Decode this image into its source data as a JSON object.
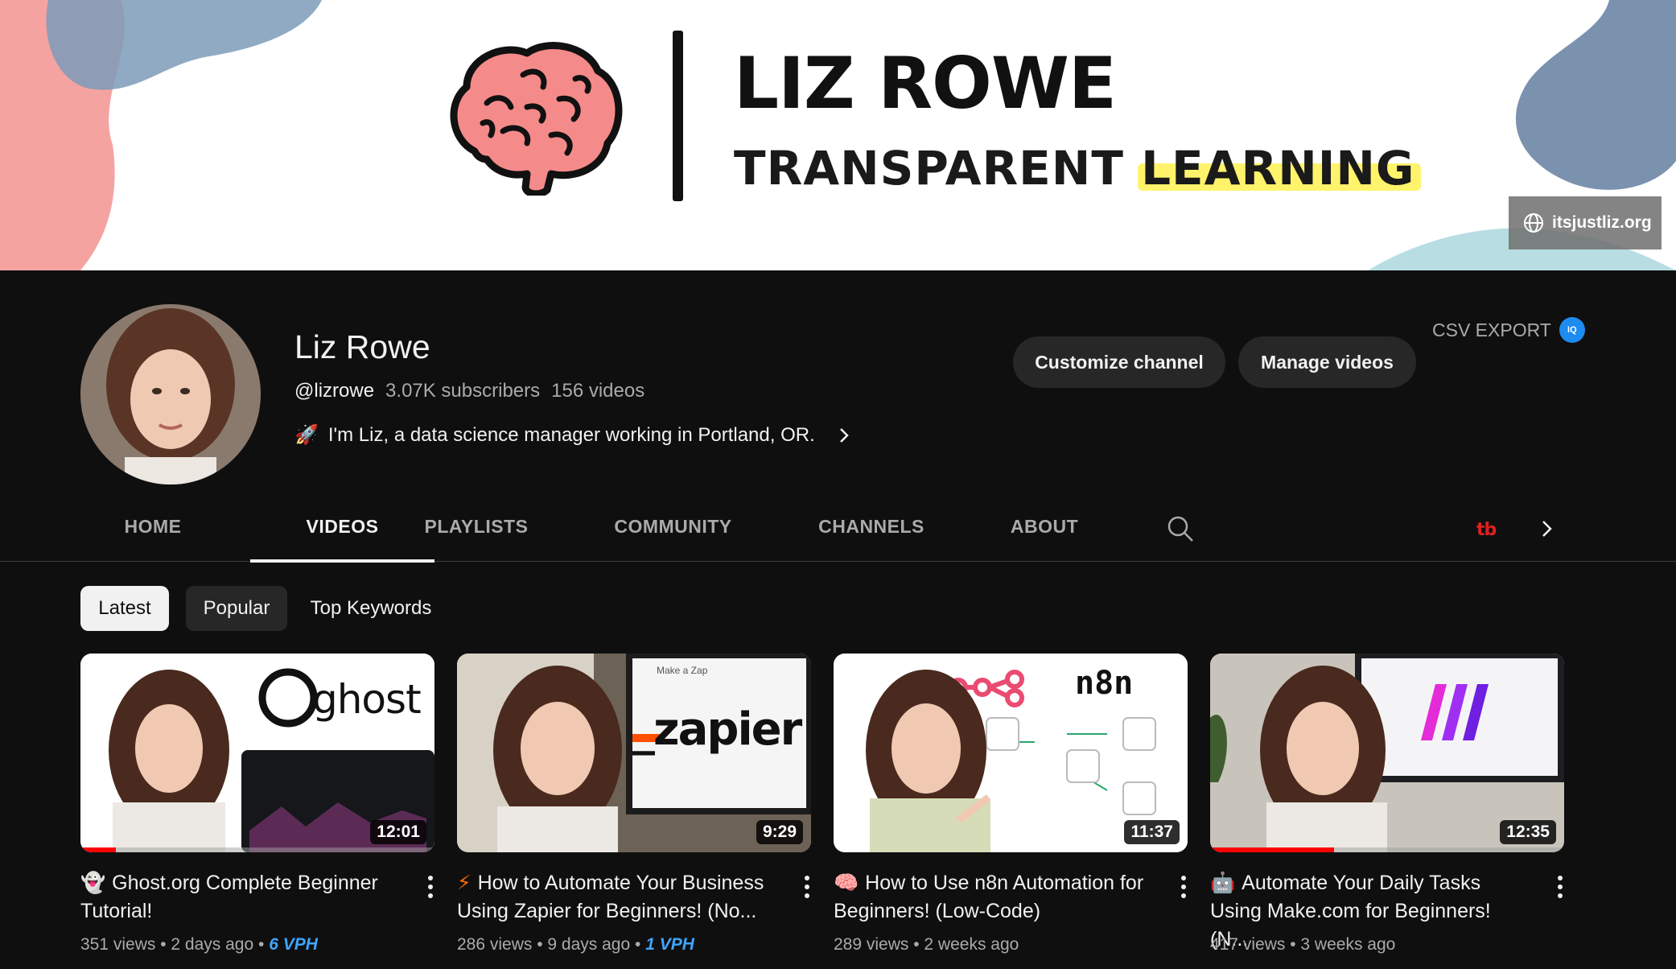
{
  "banner": {
    "title": "LIZ ROWE",
    "subtitle_part1": "TRANSPARENT ",
    "subtitle_highlight": "LEARNING",
    "link_label": "itsjustliz.org"
  },
  "channel": {
    "name": "Liz Rowe",
    "handle": "@lizrowe",
    "subscribers": "3.07K subscribers",
    "video_count": "156 videos",
    "description_emoji": "🚀",
    "description": "I'm Liz, a data science manager working in Portland, OR."
  },
  "actions": {
    "customize": "Customize channel",
    "manage": "Manage videos",
    "csv_export": "CSV EXPORT",
    "csv_badge": "IQ"
  },
  "tabs": [
    {
      "label": "HOME"
    },
    {
      "label": "VIDEOS"
    },
    {
      "label": "PLAYLISTS"
    },
    {
      "label": "COMMUNITY"
    },
    {
      "label": "CHANNELS"
    },
    {
      "label": "ABOUT"
    }
  ],
  "active_tab": "VIDEOS",
  "tubebuddy_label": "tb",
  "chips": [
    {
      "label": "Latest"
    },
    {
      "label": "Popular"
    },
    {
      "label": "Top Keywords"
    }
  ],
  "videos": [
    {
      "emoji": "👻",
      "title": "Ghost.org Complete Beginner Tutorial!",
      "duration": "12:01",
      "views": "351 views",
      "age": "2 days ago",
      "vph": "6 VPH",
      "watched_fraction": 0.1,
      "thumb_brand": "ghost"
    },
    {
      "emoji": "⚡",
      "title": "How to Automate Your Business Using Zapier for Beginners! (No...",
      "duration": "9:29",
      "views": "286 views",
      "age": "9 days ago",
      "vph": "1 VPH",
      "watched_fraction": 0,
      "thumb_brand": "_zapier",
      "thumb_caption": "Make a Zap"
    },
    {
      "emoji": "🧠",
      "title": "How to Use n8n Automation for Beginners! (Low-Code)",
      "duration": "11:37",
      "views": "289 views",
      "age": "2 weeks ago",
      "vph": "",
      "watched_fraction": 0,
      "thumb_brand": "n8n"
    },
    {
      "emoji": "🤖",
      "title": "Automate Your Daily Tasks Using Make.com for Beginners! (N...",
      "duration": "12:35",
      "views": "417 views",
      "age": "3 weeks ago",
      "vph": "",
      "watched_fraction": 0.35,
      "thumb_brand": "make"
    }
  ],
  "colors": {
    "background": "#0f0f0f",
    "pill": "#272727",
    "accent_blue": "#3ea6ff",
    "progress_red": "#ff0000",
    "highlight_yellow": "#fff36b",
    "brain_pink": "#f58a8a"
  }
}
